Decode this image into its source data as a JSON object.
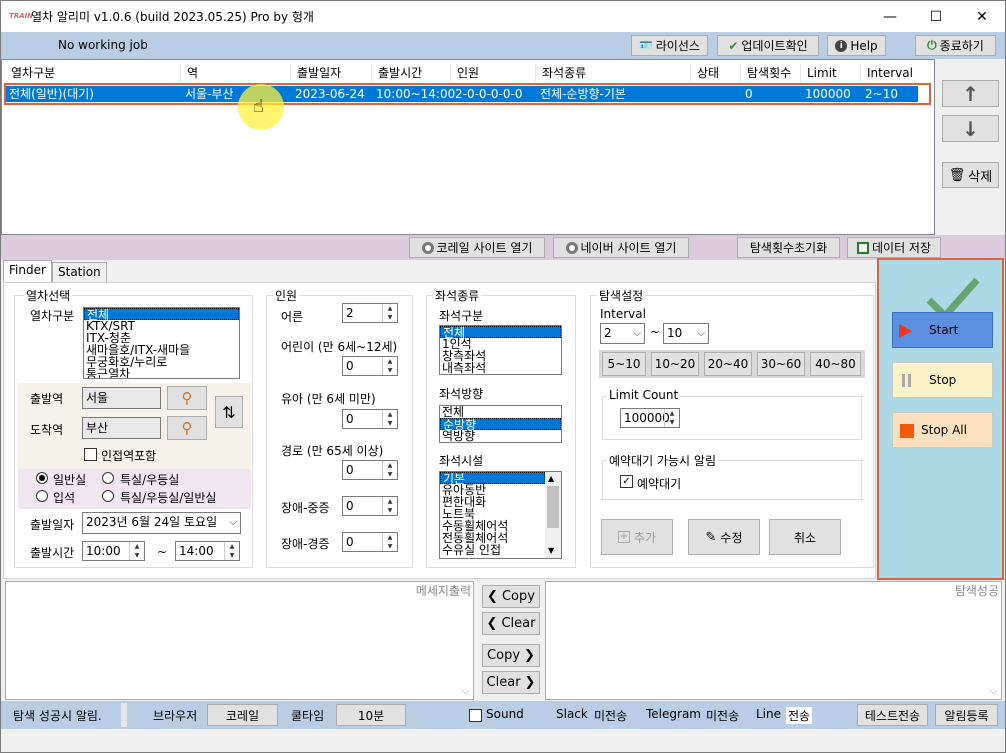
{
  "window": {
    "title": "열차 알리미 v1.0.6 (build 2023.05.25) Pro by 헝개",
    "icon_text": "TRAIN",
    "minimize": "—",
    "maximize": "☐",
    "close": "✕"
  },
  "status": {
    "text": "No working job",
    "license": "라이선스",
    "update": "업데이트확인",
    "help": "Help",
    "exit": "종료하기"
  },
  "list": {
    "headers": [
      "열차구분",
      "역",
      "출발일자",
      "출발시간",
      "인원",
      "좌석종류",
      "상태",
      "탐색횟수",
      "Limit",
      "Interval"
    ],
    "row": [
      "전체(일반)(대기)",
      "서울-부산",
      "2023-06-24",
      "10:00~14:00",
      "2-0-0-0-0-0",
      "전체-순방향-기본",
      "",
      "0",
      "100000",
      "2~10"
    ]
  },
  "side": {
    "up": "↑",
    "down": "↓",
    "delete": "삭제"
  },
  "midbar": {
    "korail_site": "코레일 사이트 열기",
    "naver_site": "네이버 사이트 열기",
    "reset_count": "탐색횟수초기화",
    "save_data": "데이터 저장"
  },
  "tabs": [
    "Finder",
    "Station"
  ],
  "train_select": {
    "group_title": "열차선택",
    "type_label": "열차구분",
    "type_options": [
      "전체",
      "KTX/SRT",
      "ITX-청춘",
      "새마을호/ITX-새마을",
      "무궁화호/누리로",
      "통근열차"
    ],
    "depart_label": "출발역",
    "depart_value": "서울",
    "arrive_label": "도착역",
    "arrive_value": "부산",
    "nearby_label": "인접역포함",
    "radio_general": "일반실",
    "radio_special": "특실/우등실",
    "radio_standing": "입석",
    "radio_special_general": "특실/우등실/일반실",
    "date_label": "출발일자",
    "date_value": "2023년   6월 24일 토요일",
    "time_label": "출발시간",
    "time_from": "10:00",
    "time_sep": "~",
    "time_to": "14:00"
  },
  "people": {
    "group_title": "인원",
    "adult_label": "어른",
    "adult_value": "2",
    "child_label": "어린이 (만 6세~12세)",
    "child_value": "0",
    "infant_label": "유아 (만 6세 미만)",
    "infant_value": "0",
    "senior_label": "경로 (만 65세 이상)",
    "senior_value": "0",
    "disabled_severe_label": "장애-중증",
    "disabled_severe_value": "0",
    "disabled_mild_label": "장애-경증",
    "disabled_mild_value": "0"
  },
  "seats": {
    "group_title": "좌석종류",
    "type_label": "좌석구분",
    "type_options": [
      "전체",
      "1인석",
      "창측좌석",
      "내측좌석"
    ],
    "dir_label": "좌석방향",
    "dir_options": [
      "전체",
      "순방향",
      "역방향"
    ],
    "facility_label": "좌석시설",
    "facility_options": [
      "기본",
      "유아동반",
      "편한대화",
      "노트북",
      "수동휠체어석",
      "전동휠체어석",
      "수유실 인접"
    ]
  },
  "search": {
    "group_title": "탐색설정",
    "interval_label": "Interval",
    "interval_from": "2",
    "interval_sep": "~",
    "interval_to": "10",
    "presets": [
      "5~10",
      "10~20",
      "20~40",
      "30~60",
      "40~80"
    ],
    "limit_label": "Limit Count",
    "limit_value": "100000",
    "reserve_group": "예약대기 가능시 알림",
    "reserve_check": "예약대기",
    "add": "추가",
    "edit": "수정",
    "cancel": "취소"
  },
  "actions": {
    "start": "Start",
    "stop": "Stop",
    "stop_all": "Stop All"
  },
  "output": {
    "message_label": "메세지출력",
    "success_label": "탐색성공",
    "copy": "Copy",
    "clear": "Clear"
  },
  "bottom": {
    "notify": "탐색 성공시 알림.",
    "browser_label": "브라우저",
    "browser_value": "코레일",
    "cooltime_label": "쿨타임",
    "cooltime_value": "10분",
    "sound": "Sound",
    "slack": "Slack",
    "slack_status": "미전송",
    "telegram": "Telegram",
    "telegram_status": "미전송",
    "line": "Line",
    "line_status": "전송",
    "test_send": "테스트전송",
    "alarm_register": "알림등록"
  },
  "colors": {
    "selection": "#0078d7",
    "highlight": "#e2603a",
    "status_bg": "#b9cde4",
    "action_bg": "#add8e6",
    "start_bg": "#5b8fe0",
    "stop_bg": "#fbf3c8",
    "stopall_bg": "#fbe0c0",
    "check_green": "#5a9e5a"
  }
}
